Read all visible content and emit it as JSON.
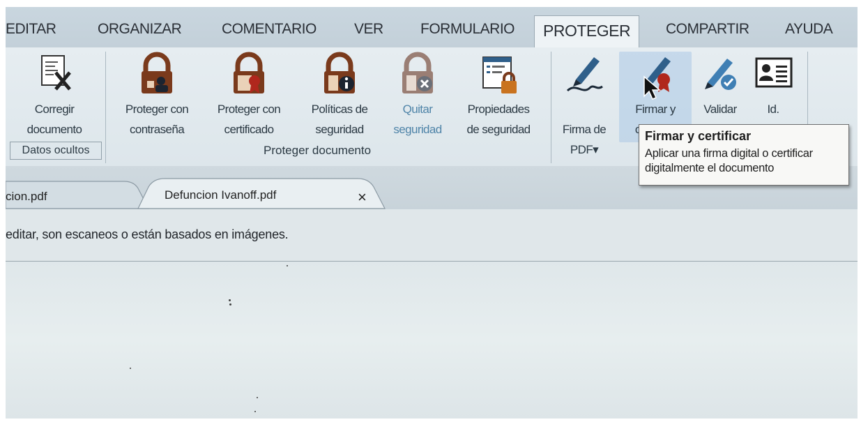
{
  "menu": {
    "tabs": [
      {
        "label": "EDITAR"
      },
      {
        "label": "ORGANIZAR"
      },
      {
        "label": "COMENTARIO"
      },
      {
        "label": "VER"
      },
      {
        "label": "FORMULARIO"
      },
      {
        "label": "PROTEGER",
        "active": true
      },
      {
        "label": "COMPARTIR"
      },
      {
        "label": "AYUDA"
      }
    ]
  },
  "ribbon": {
    "buttons": [
      {
        "label": "Corregir\ndocumento",
        "icon": "redact-document-icon"
      },
      {
        "label": "Proteger con\ncontraseña",
        "icon": "password-lock-icon"
      },
      {
        "label": "Proteger con\ncertificado",
        "icon": "certificate-lock-icon"
      },
      {
        "label": "Políticas de\nseguridad",
        "icon": "policy-lock-icon"
      },
      {
        "label": "Quitar\nseguridad",
        "icon": "remove-security-icon",
        "disabled": true
      },
      {
        "label": "Propiedades\nde seguridad",
        "icon": "security-properties-icon"
      },
      {
        "label": "Firma de\nPDF",
        "icon": "pdf-signature-icon",
        "dropdown": "▾"
      },
      {
        "label": "Firmar y\ncertificar",
        "icon": "sign-certify-icon",
        "hover": true
      },
      {
        "label": "Validar",
        "icon": "validate-signature-icon"
      },
      {
        "label": "Id.",
        "icon": "id-card-icon"
      }
    ],
    "groups": {
      "hidden_data": "Datos ocultos",
      "protect_document": "Proteger documento"
    }
  },
  "tooltip": {
    "title": "Firmar y certificar",
    "body": "Aplicar una firma digital o certificar digitalmente el documento"
  },
  "doc_tabs": [
    {
      "label": "cion.pdf"
    },
    {
      "label": "Defuncion Ivanoff.pdf",
      "active": true,
      "close": "×"
    }
  ],
  "notice": {
    "text": "editar, son escaneos o están basados en imágenes."
  },
  "colors": {
    "lock_brown": "#7a3a1c",
    "signature_blue": "#2f5f8a",
    "ribbon_bg": "#e3eaee",
    "hover_blue": "#b4cde6"
  }
}
